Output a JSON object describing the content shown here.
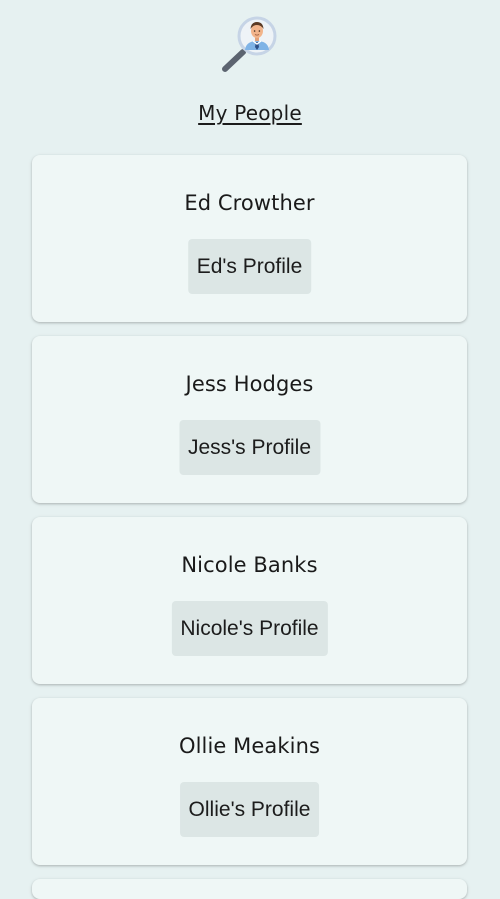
{
  "header": {
    "logo_icon": "person-search-icon",
    "title": "My People"
  },
  "people": [
    {
      "name": "Ed Crowther",
      "button_label": "Ed's Profile"
    },
    {
      "name": "Jess Hodges",
      "button_label": "Jess's Profile"
    },
    {
      "name": "Nicole Banks",
      "button_label": "Nicole's Profile"
    },
    {
      "name": "Ollie Meakins",
      "button_label": "Ollie's Profile"
    }
  ],
  "colors": {
    "background": "#e6f1f1",
    "card": "#eff7f6",
    "button": "#dce6e5",
    "text": "#1b1b1b"
  }
}
